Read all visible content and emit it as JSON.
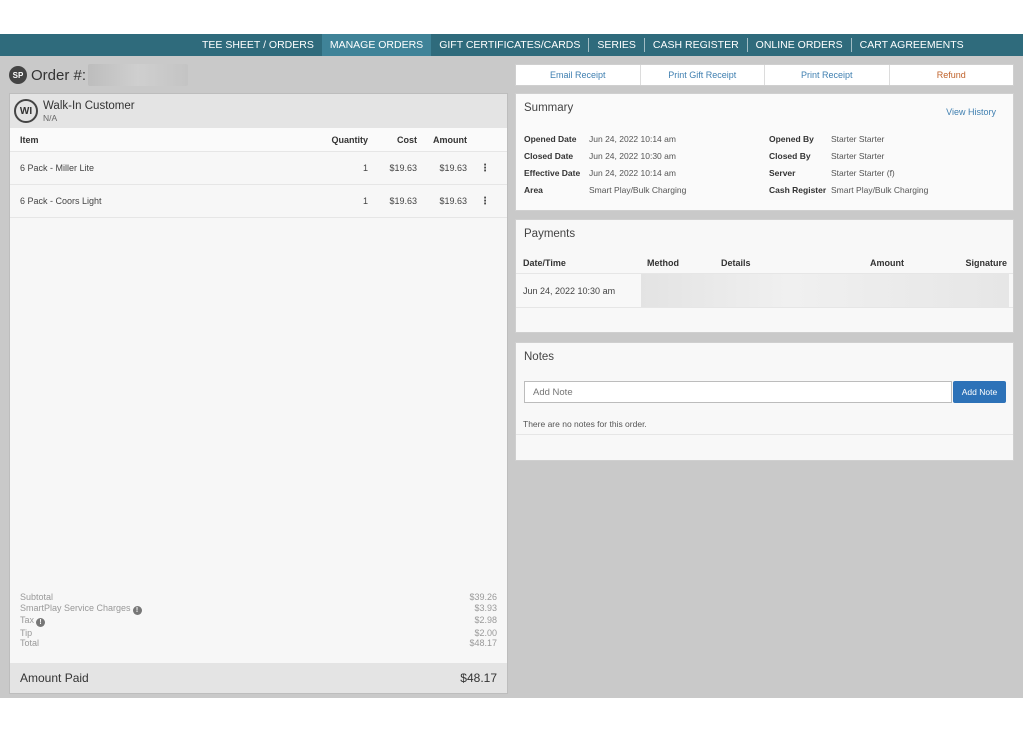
{
  "nav": {
    "items": [
      {
        "label": "TEE SHEET / ORDERS",
        "active": false
      },
      {
        "label": "MANAGE ORDERS",
        "active": true
      },
      {
        "label": "GIFT CERTIFICATES/CARDS",
        "active": false
      },
      {
        "label": "SERIES",
        "active": false
      },
      {
        "label": "CASH REGISTER",
        "active": false
      },
      {
        "label": "ONLINE ORDERS",
        "active": false
      },
      {
        "label": "CART AGREEMENTS",
        "active": false
      }
    ]
  },
  "order": {
    "badge": "SP",
    "title": "Order #:"
  },
  "customer": {
    "badge": "WI",
    "name": "Walk-In Customer",
    "sub": "N/A"
  },
  "items": {
    "headers": {
      "item": "Item",
      "quantity": "Quantity",
      "cost": "Cost",
      "amount": "Amount"
    },
    "rows": [
      {
        "item": "6 Pack - Miller Lite",
        "quantity": "1",
        "cost": "$19.63",
        "amount": "$19.63"
      },
      {
        "item": "6 Pack - Coors Light",
        "quantity": "1",
        "cost": "$19.63",
        "amount": "$19.63"
      }
    ]
  },
  "totals": {
    "subtotal_label": "Subtotal",
    "subtotal": "$39.26",
    "service_label": "SmartPlay Service Charges",
    "service": "$3.93",
    "tax_label": "Tax",
    "tax": "$2.98",
    "tip_label": "Tip",
    "tip": "$2.00",
    "total_label": "Total",
    "total": "$48.17",
    "amount_paid_label": "Amount Paid",
    "amount_paid": "$48.17"
  },
  "actions": {
    "email": "Email Receipt",
    "gift": "Print Gift Receipt",
    "print": "Print Receipt",
    "refund": "Refund"
  },
  "summary": {
    "title": "Summary",
    "view_history": "View History",
    "opened_date_label": "Opened Date",
    "opened_date": "Jun 24, 2022 10:14 am",
    "closed_date_label": "Closed Date",
    "closed_date": "Jun 24, 2022 10:30 am",
    "effective_date_label": "Effective Date",
    "effective_date": "Jun 24, 2022 10:14 am",
    "area_label": "Area",
    "area": "Smart Play/Bulk Charging",
    "opened_by_label": "Opened By",
    "opened_by": "Starter Starter",
    "closed_by_label": "Closed By",
    "closed_by": "Starter Starter",
    "server_label": "Server",
    "server": "Starter Starter (f)",
    "cash_register_label": "Cash Register",
    "cash_register": "Smart Play/Bulk Charging"
  },
  "payments": {
    "title": "Payments",
    "headers": {
      "datetime": "Date/Time",
      "method": "Method",
      "details": "Details",
      "amount": "Amount",
      "signature": "Signature"
    },
    "rows": [
      {
        "datetime": "Jun 24, 2022 10:30 am"
      }
    ]
  },
  "notes": {
    "title": "Notes",
    "placeholder": "Add Note",
    "button": "Add Note",
    "empty": "There are no notes for this order."
  },
  "colors": {
    "nav_bg": "#2f6b7c",
    "nav_active": "#3f8398",
    "link": "#3f7fb0",
    "refund": "#c0622a",
    "primary_button": "#2d72b8"
  }
}
